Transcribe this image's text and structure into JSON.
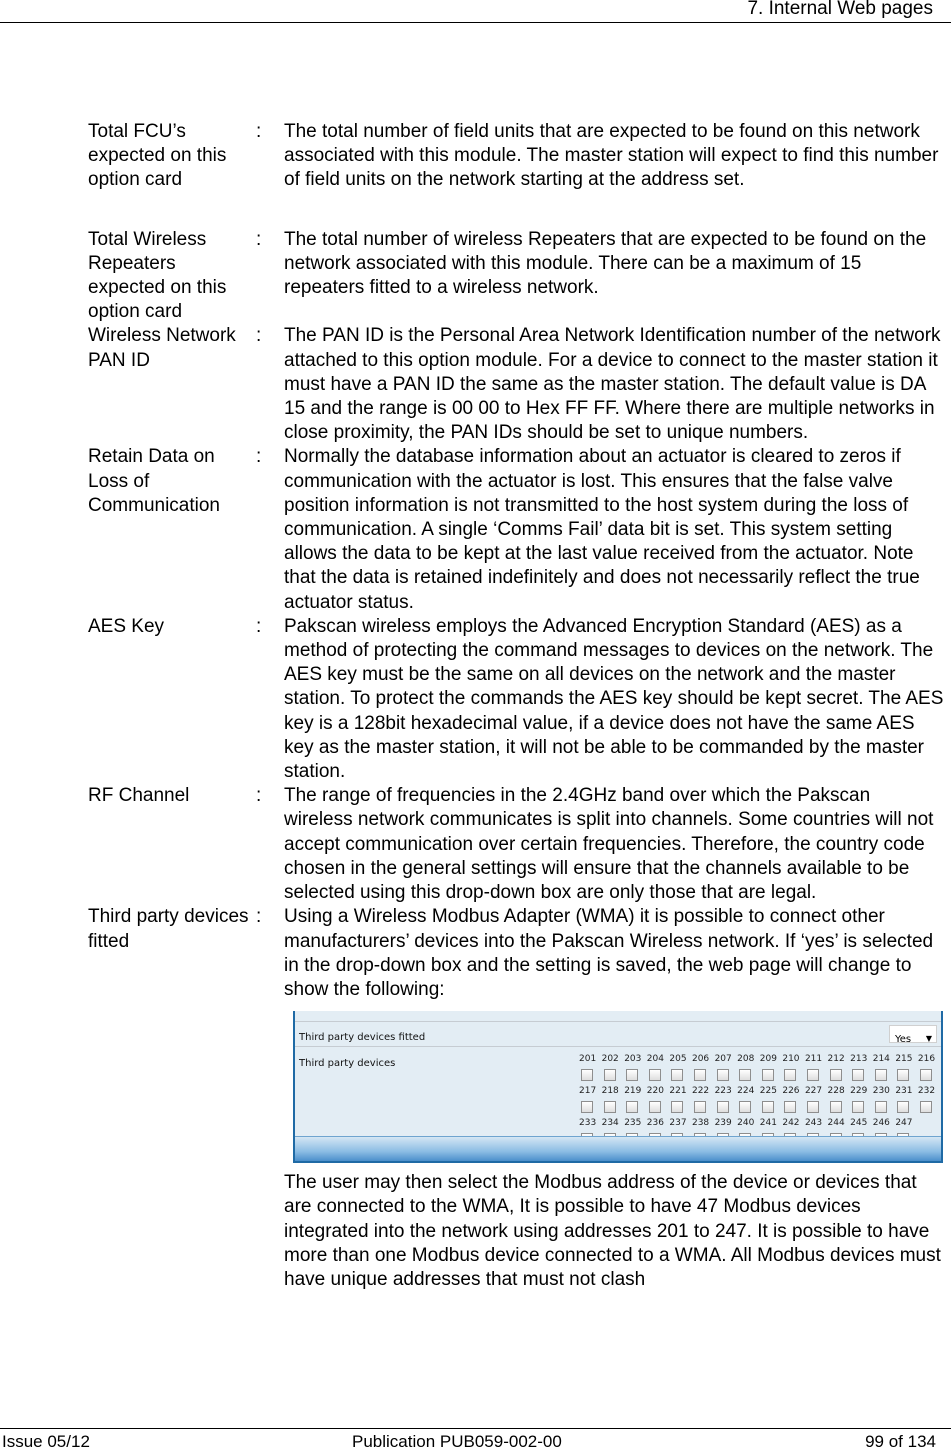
{
  "header": {
    "section_title": "7. Internal Web pages"
  },
  "definitions": [
    {
      "term": "Total FCU’s expected on this option card",
      "separator": ":",
      "description": "The total number of field units that are expected to be found on this network associated with this module.  The master station will expect to find this number of field units on the network starting at the address set."
    },
    {
      "term": "Total Wireless Repeaters expected on this option card",
      "separator": ":",
      "description": "The total number of wireless Repeaters that are expected to be found on the network associated with this module.  There can be a maximum of 15 repeaters fitted to a wireless network."
    },
    {
      "term": "Wireless Network PAN ID",
      "separator": ":",
      "description": "The PAN ID is the Personal Area Network Identification number of the network attached to this option module.  For a device to connect to the master station it must have a PAN ID the same as the master station. The default value is DA 15 and the range is 00 00 to Hex FF FF. Where there are multiple networks in close proximity, the PAN IDs should be set to unique numbers."
    },
    {
      "term": "Retain Data on Loss of Communication",
      "separator": ":",
      "description": "Normally the database information about an actuator is cleared to zeros if communication with the actuator is lost. This ensures that the false valve position information is not transmitted to the host system during the loss of communication. A single ‘Comms Fail’ data bit is set. This system setting allows the data to be kept at the last value received from the actuator. Note that the data is retained indefinitely and does not necessarily reflect the true actuator status."
    },
    {
      "term": "AES Key",
      "separator": ":",
      "description": "Pakscan wireless employs the Advanced Encryption Standard (AES) as a method of protecting the command messages to devices on the network.  The AES key must be the same on all devices on the network and the master station.  To protect the commands the AES key should be kept secret.  The AES key is a 128bit hexadecimal value, if a device does not have the same AES key as the master station, it will not be able to be commanded by the master station."
    },
    {
      "term": "RF Channel",
      "separator": ":",
      "description": "The range of frequencies in the 2.4GHz band over which the Pakscan wireless network communicates is split into channels.  Some countries will not accept communication over certain frequencies.  Therefore, the country code chosen in the general settings will ensure that the channels available to be selected using this drop-down box are only those that are legal."
    },
    {
      "term": "Third party devices fitted",
      "separator": ":",
      "description": "Using a Wireless Modbus Adapter (WMA) it is possible to connect other manufacturers’ devices into the Pakscan Wireless network.  If ‘yes’ is selected in the drop-down box and the setting is saved, the web page will change to show the following:"
    }
  ],
  "embedded_screenshot": {
    "fitted_label": "Third party devices fitted",
    "fitted_value": "Yes",
    "devices_label": "Third party devices",
    "address_rows": [
      [
        "201",
        "202",
        "203",
        "204",
        "205",
        "206",
        "207",
        "208",
        "209",
        "210",
        "211",
        "212",
        "213",
        "214",
        "215",
        "216"
      ],
      [
        "217",
        "218",
        "219",
        "220",
        "221",
        "222",
        "223",
        "224",
        "225",
        "226",
        "227",
        "228",
        "229",
        "230",
        "231",
        "232"
      ],
      [
        "233",
        "234",
        "235",
        "236",
        "237",
        "238",
        "239",
        "240",
        "241",
        "242",
        "243",
        "244",
        "245",
        "246",
        "247"
      ]
    ],
    "checked": []
  },
  "after_text": "The user may then select the Modbus address of the device or devices that are connected to the WMA,  It is possible to have 47 Modbus devices integrated into the network using addresses 201 to 247.  It is possible to have more than one Modbus device connected to a WMA. All Modbus devices must have unique addresses that must not clash",
  "footer": {
    "issue": "Issue 05/12",
    "publication": "Publication PUB059-002-00",
    "page": "99 of 134"
  }
}
